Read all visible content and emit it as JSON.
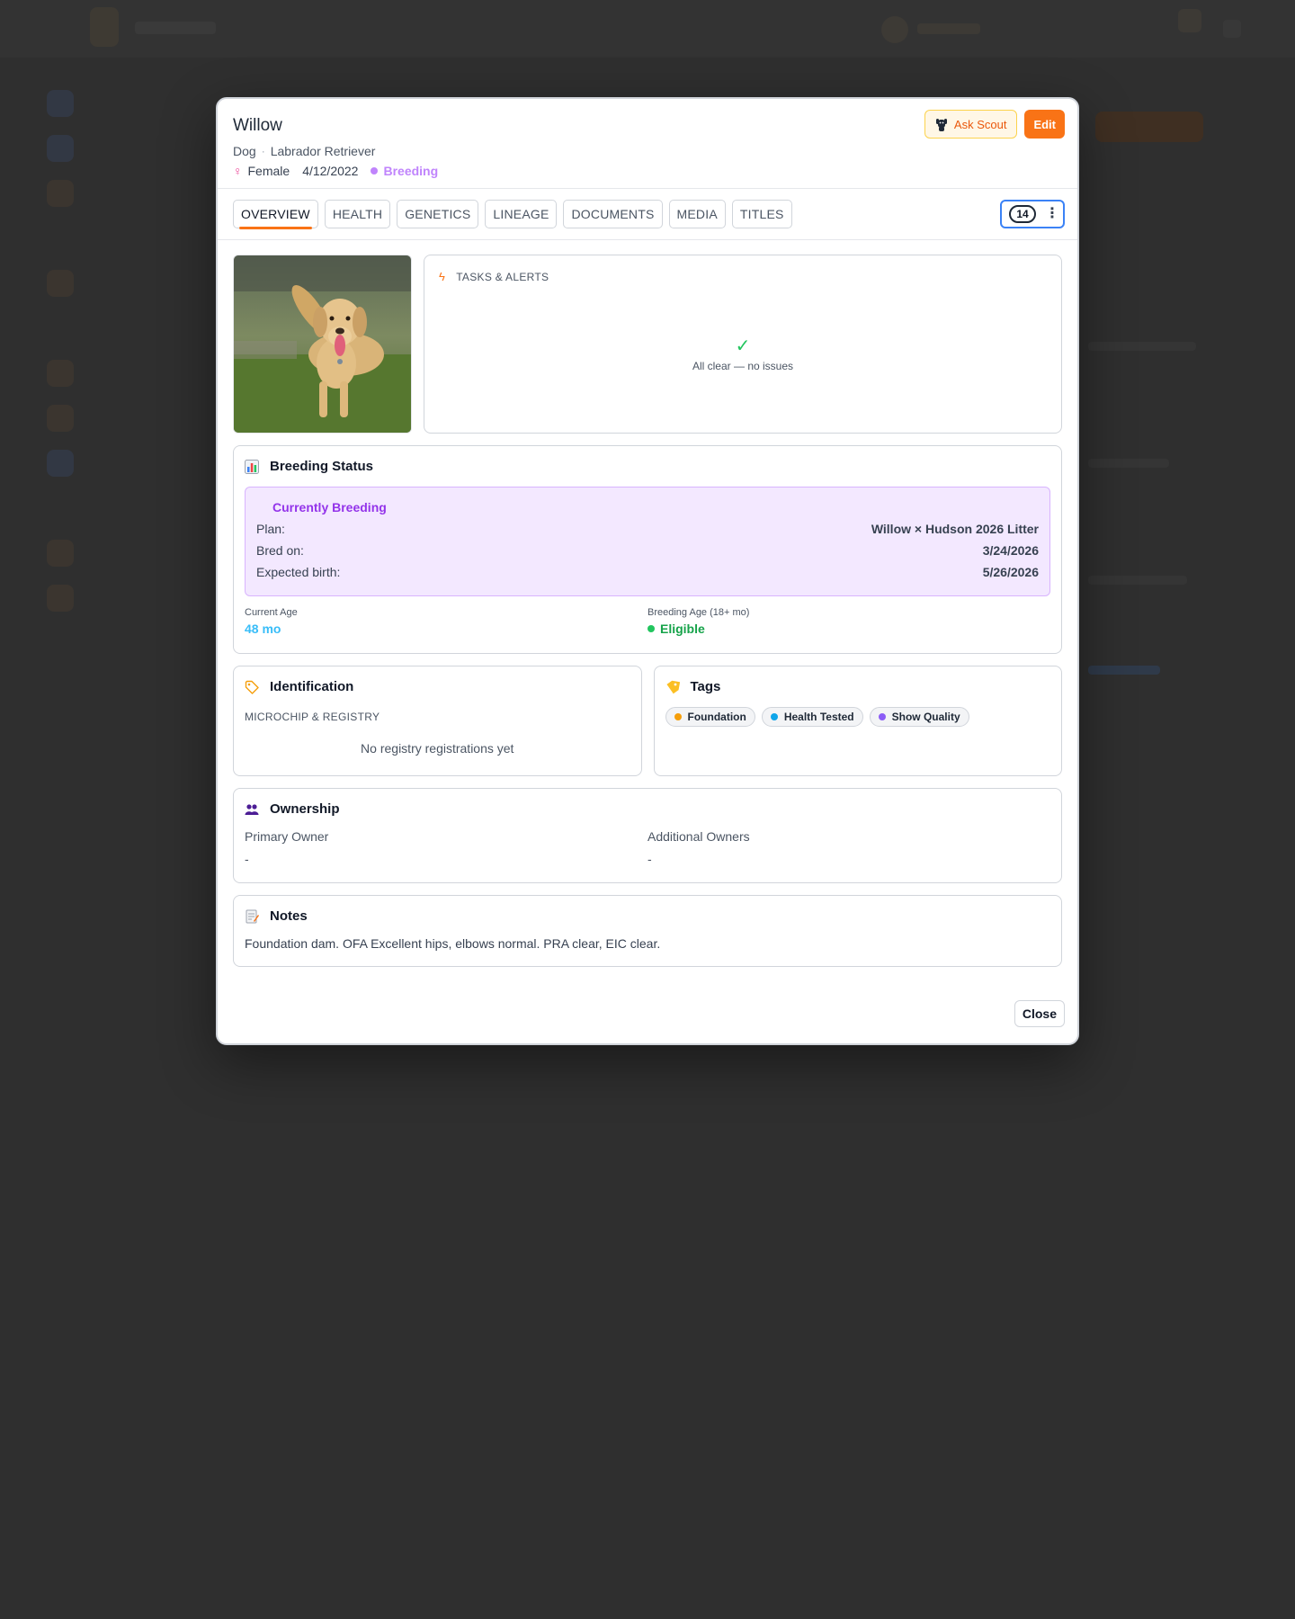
{
  "animal": {
    "name": "Willow",
    "species": "Dog",
    "breed": "Labrador Retriever",
    "sex": "Female",
    "dob": "4/12/2022",
    "status": "Breeding"
  },
  "actions": {
    "ask_scout": "Ask Scout",
    "edit": "Edit",
    "close": "Close"
  },
  "tabs": [
    {
      "label": "OVERVIEW"
    },
    {
      "label": "HEALTH"
    },
    {
      "label": "GENETICS"
    },
    {
      "label": "LINEAGE"
    },
    {
      "label": "DOCUMENTS"
    },
    {
      "label": "MEDIA"
    },
    {
      "label": "TITLES"
    }
  ],
  "tab_count": "14",
  "tasks": {
    "title": "TASKS & ALERTS",
    "empty": "All clear — no issues"
  },
  "breeding": {
    "title": "Breeding Status",
    "box_title": "Currently Breeding",
    "plan_label": "Plan:",
    "plan_value": "Willow × Hudson 2026 Litter",
    "bred_label": "Bred on:",
    "bred_value": "3/24/2026",
    "birth_label": "Expected birth:",
    "birth_value": "5/26/2026",
    "age_label": "Current Age",
    "age_value": "48 mo",
    "breeding_age_label": "Breeding Age (18+ mo)",
    "breeding_age_value": "Eligible"
  },
  "identification": {
    "title": "Identification",
    "subtitle": "MICROCHIP & REGISTRY",
    "empty": "No registry registrations yet"
  },
  "tags": {
    "title": "Tags",
    "items": [
      {
        "label": "Foundation",
        "color": "#f59e0b"
      },
      {
        "label": "Health Tested",
        "color": "#0ea5e9"
      },
      {
        "label": "Show Quality",
        "color": "#8b5cf6"
      }
    ]
  },
  "ownership": {
    "title": "Ownership",
    "primary_label": "Primary Owner",
    "primary_value": "-",
    "additional_label": "Additional Owners",
    "additional_value": "-"
  },
  "notes": {
    "title": "Notes",
    "text": "Foundation dam. OFA Excellent hips, elbows normal. PRA clear, EIC clear."
  },
  "colors": {
    "accent": "#f97316",
    "breeding": "#c084fc",
    "eligible": "#16a34a"
  }
}
